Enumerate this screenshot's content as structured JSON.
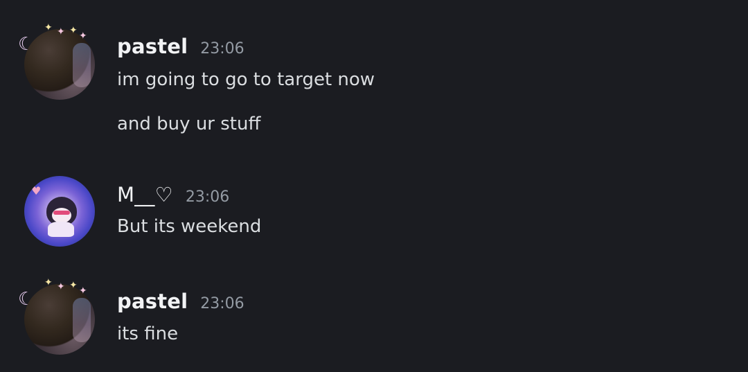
{
  "messages": [
    {
      "username": "pastel",
      "timestamp": "23:06",
      "lines": [
        "im going to go to target now",
        "and buy ur stuff"
      ],
      "avatar_icon": "cat-avatar-with-star-decoration"
    },
    {
      "username": "M__♡",
      "timestamp": "23:06",
      "lines": [
        "But its weekend"
      ],
      "avatar_icon": "kuromi-avatar"
    },
    {
      "username": "pastel",
      "timestamp": "23:06",
      "lines": [
        "its fine"
      ],
      "avatar_icon": "cat-avatar-with-star-decoration"
    }
  ],
  "colors": {
    "background": "#1b1c21",
    "username": "#f2f3f5",
    "message_text": "#dbdee1",
    "timestamp": "#949ba4"
  }
}
